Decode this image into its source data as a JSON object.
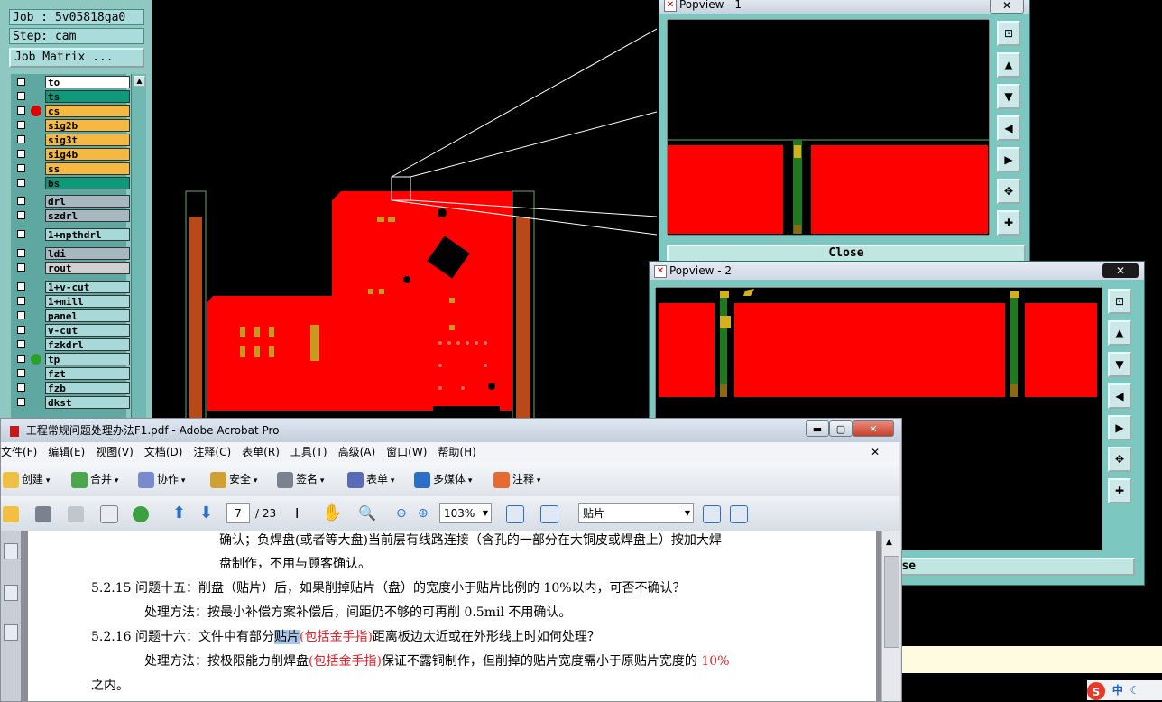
{
  "cam": {
    "job_label": "Job : 5v05818ga0",
    "step_label": "Step: cam",
    "job_matrix_button": "Job Matrix ...",
    "layers": [
      {
        "name": "to",
        "color": "#ffffff",
        "dot": ""
      },
      {
        "name": "ts",
        "color": "#0d9a7a",
        "dot": ""
      },
      {
        "name": "cs",
        "color": "#f5b942",
        "dot": "#e00000"
      },
      {
        "name": "sig2b",
        "color": "#f5b942",
        "dot": ""
      },
      {
        "name": "sig3t",
        "color": "#f5b942",
        "dot": ""
      },
      {
        "name": "sig4b",
        "color": "#f5b942",
        "dot": ""
      },
      {
        "name": "ss",
        "color": "#f5b942",
        "dot": ""
      },
      {
        "name": "bs",
        "color": "#0d9a7a",
        "dot": ""
      },
      {
        "name": "drl",
        "color": "#a8b8c0",
        "dot": ""
      },
      {
        "name": "szdrl",
        "color": "#a8b8c0",
        "dot": ""
      },
      {
        "name": "1+npthdrl",
        "color": "#a8d8d8",
        "dot": ""
      },
      {
        "name": "ldi",
        "color": "#a8b8c0",
        "dot": ""
      },
      {
        "name": "rout",
        "color": "#d0d0d0",
        "dot": ""
      },
      {
        "name": "1+v-cut",
        "color": "#a8d8d8",
        "dot": ""
      },
      {
        "name": "1+mill",
        "color": "#a8d8d8",
        "dot": ""
      },
      {
        "name": "panel",
        "color": "#a8d8d8",
        "dot": ""
      },
      {
        "name": "v-cut",
        "color": "#a8d8d8",
        "dot": ""
      },
      {
        "name": "fzkdrl",
        "color": "#a8d8d8",
        "dot": ""
      },
      {
        "name": "tp",
        "color": "#a8d8d8",
        "dot": "#2aa02a"
      },
      {
        "name": "fzt",
        "color": "#a8d8d8",
        "dot": ""
      },
      {
        "name": "fzb",
        "color": "#a8d8d8",
        "dot": ""
      },
      {
        "name": "dkst",
        "color": "#a8d8d8",
        "dot": ""
      }
    ]
  },
  "popview1": {
    "title": "Popview - 1",
    "close_label": "Close"
  },
  "popview2": {
    "title": "Popview - 2",
    "close_label": "Close"
  },
  "acrobat": {
    "title": "工程常规问题处理办法F1.pdf - Adobe Acrobat Pro",
    "menu": [
      "文件(F)",
      "编辑(E)",
      "视图(V)",
      "文档(D)",
      "注释(C)",
      "表单(R)",
      "工具(T)",
      "高级(A)",
      "窗口(W)",
      "帮助(H)"
    ],
    "tools": [
      "创建",
      "合并",
      "协作",
      "安全",
      "签名",
      "表单",
      "多媒体",
      "注释"
    ],
    "page_current": "7",
    "page_total": "/ 23",
    "zoom": "103%",
    "search": "贴片",
    "lines": [
      {
        "a": "确认；负焊盘(或者等大盘)当前层有线路连接（含孔的一部分在大铜皮或焊盘上）按加大焊"
      },
      {
        "a": "盘制作，不用与顾客确认。"
      },
      {
        "a": "5.2.15  问题十五：削盘（贴片）后，如果削掉贴片（盘）的宽度小于贴片比例的 10%以内，可否不确认？"
      },
      {
        "a": "处理方法：按最小补偿方案补偿后，间距仍不够的可再削 0.5mil 不用确认。"
      },
      {
        "a": "5.2.16  问题十六：文件中有部分",
        "hl": "贴片",
        "red": "(包括金手指)",
        "b": "距离板边太近或在外形线上时如何处理？"
      },
      {
        "a": "处理方法：按极限能力削焊盘",
        "red": "(包括金手指)",
        "b": "保证不露铜制作，但削掉的贴片宽度需小于原贴片宽度的 ",
        "red2": "10%"
      },
      {
        "a": "之内。"
      }
    ]
  },
  "tray": {
    "ime": "中"
  }
}
